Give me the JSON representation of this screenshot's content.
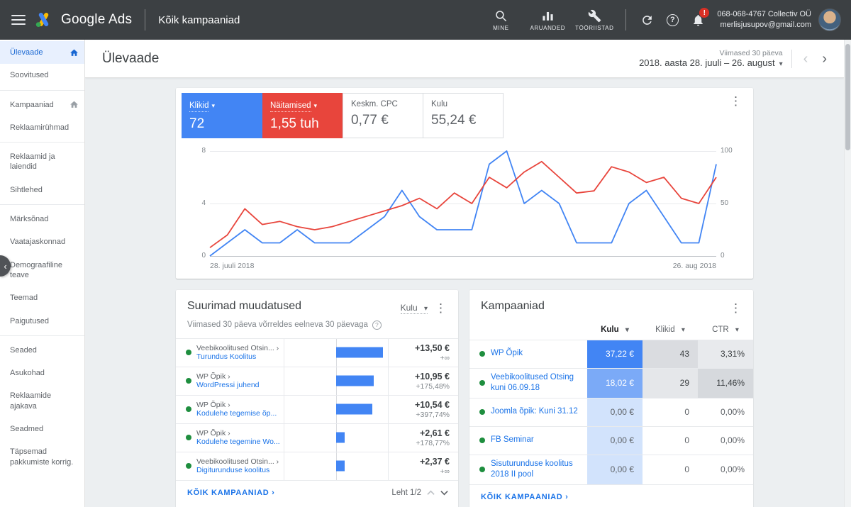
{
  "topbar": {
    "brand": "Google Ads",
    "page_title": "Kõik kampaaniad",
    "actions": [
      {
        "label": "MINE"
      },
      {
        "label": "ARUANDED"
      },
      {
        "label": "TÖÖRIISTAD"
      }
    ],
    "alert_badge": "!",
    "account_name": "068-068-4767 Collectiv OÜ",
    "account_email": "merlisjusupov@gmail.com"
  },
  "sidebar": {
    "items": [
      {
        "label": "Ülevaade"
      },
      {
        "label": "Soovitused"
      },
      {
        "label": "Kampaaniad"
      },
      {
        "label": "Reklaamirühmad"
      },
      {
        "label": "Reklaamid ja laiendid"
      },
      {
        "label": "Sihtlehed"
      },
      {
        "label": "Märksõnad"
      },
      {
        "label": "Vaatajaskonnad"
      },
      {
        "label": "Demograafiline teave"
      },
      {
        "label": "Teemad"
      },
      {
        "label": "Paigutused"
      },
      {
        "label": "Seaded"
      },
      {
        "label": "Asukohad"
      },
      {
        "label": "Reklaamide ajakava"
      },
      {
        "label": "Seadmed"
      },
      {
        "label": "Täpsemad pakkumiste korrig."
      }
    ]
  },
  "header": {
    "title": "Ülevaade",
    "date_preset": "Viimased 30 päeva",
    "date_range": "2018. aasta 28. juuli – 26. august"
  },
  "metrics": [
    {
      "label": "Klikid",
      "value": "72",
      "color": "#4285f4"
    },
    {
      "label": "Näitamised",
      "value": "1,55 tuh",
      "color": "#e8453c"
    },
    {
      "label": "Keskm. CPC",
      "value": "0,77 €"
    },
    {
      "label": "Kulu",
      "value": "55,24 €"
    }
  ],
  "chart_data": {
    "type": "line",
    "x_start_label": "28. juuli 2018",
    "x_end_label": "26. aug 2018",
    "left_axis": {
      "ticks": [
        "8",
        "4",
        "0"
      ],
      "max": 8
    },
    "right_axis": {
      "ticks": [
        "100",
        "50",
        "0"
      ],
      "max": 100
    },
    "series": [
      {
        "name": "Klikid",
        "axis": "left",
        "color": "#4285f4",
        "values": [
          0,
          1,
          2,
          1,
          1,
          2,
          1,
          1,
          1,
          2,
          3,
          5,
          3,
          2,
          2,
          2,
          7,
          8,
          4,
          5,
          4,
          1,
          1,
          1,
          4,
          5,
          3,
          1,
          1,
          7
        ]
      },
      {
        "name": "Näitamised",
        "axis": "right",
        "color": "#e8453c",
        "values": [
          8,
          20,
          45,
          30,
          33,
          28,
          25,
          28,
          33,
          38,
          43,
          48,
          55,
          45,
          60,
          50,
          75,
          65,
          80,
          90,
          75,
          60,
          62,
          85,
          80,
          70,
          75,
          55,
          50,
          75
        ]
      }
    ]
  },
  "top_changes": {
    "title": "Suurimad muudatused",
    "subtitle": "Viimased 30 päeva võrreldes eelneva 30 päevaga",
    "metric_selector": "Kulu",
    "rows": [
      {
        "path": "Veebikoolitused Otsin... ›",
        "name": "Turundus Koolitus",
        "bar_pct": 100,
        "change": "+13,50 €",
        "change_pct": "+∞"
      },
      {
        "path": "WP Õpik ›",
        "name": "WordPressi juhend",
        "bar_pct": 81,
        "change": "+10,95 €",
        "change_pct": "+175,48%"
      },
      {
        "path": "WP Õpik ›",
        "name": "Kodulehe tegemise õp...",
        "bar_pct": 78,
        "change": "+10,54 €",
        "change_pct": "+397,74%"
      },
      {
        "path": "WP Õpik ›",
        "name": "Kodulehe tegemine Wo...",
        "bar_pct": 19,
        "change": "+2,61 €",
        "change_pct": "+178,77%"
      },
      {
        "path": "Veebikoolitused Otsin... ›",
        "name": "Digiturunduse koolitus",
        "bar_pct": 18,
        "change": "+2,37 €",
        "change_pct": "+∞"
      }
    ],
    "footer_link": "KÕIK KAMPAANIAD",
    "footer_arrow": "›",
    "pagination": "Leht 1/2"
  },
  "campaigns": {
    "title": "Kampaaniad",
    "columns": [
      {
        "label": "Kulu"
      },
      {
        "label": "Klikid"
      },
      {
        "label": "CTR"
      }
    ],
    "rows": [
      {
        "name": "WP Õpik",
        "kulu": "37,22 €",
        "klikid": "43",
        "ctr": "3,31%",
        "kulu_bg": "#4285f4",
        "kulu_fg": "#ffffff",
        "klikid_bg": "#dadce0",
        "klikid_fg": "#3c4043",
        "ctr_bg": "#e8eaed",
        "ctr_fg": "#3c4043"
      },
      {
        "name": "Veebikoolitused Otsing kuni 06.09.18",
        "kulu": "18,02 €",
        "klikid": "29",
        "ctr": "11,46%",
        "kulu_bg": "#7baaf7",
        "kulu_fg": "#ffffff",
        "klikid_bg": "#e5e7ea",
        "klikid_fg": "#3c4043",
        "ctr_bg": "#d6d9dd",
        "ctr_fg": "#3c4043"
      },
      {
        "name": "Joomla õpik: Kuni 31.12",
        "kulu": "0,00 €",
        "klikid": "0",
        "ctr": "0,00%",
        "kulu_bg": "#d2e3fc",
        "kulu_fg": "#5f6368",
        "klikid_bg": "#ffffff",
        "klikid_fg": "#5f6368",
        "ctr_bg": "#ffffff",
        "ctr_fg": "#5f6368"
      },
      {
        "name": "FB Seminar",
        "kulu": "0,00 €",
        "klikid": "0",
        "ctr": "0,00%",
        "kulu_bg": "#d2e3fc",
        "kulu_fg": "#5f6368",
        "klikid_bg": "#ffffff",
        "klikid_fg": "#5f6368",
        "ctr_bg": "#ffffff",
        "ctr_fg": "#5f6368"
      },
      {
        "name": "Sisuturunduse koolitus 2018 II pool",
        "kulu": "0,00 €",
        "klikid": "0",
        "ctr": "0,00%",
        "kulu_bg": "#d2e3fc",
        "kulu_fg": "#5f6368",
        "klikid_bg": "#ffffff",
        "klikid_fg": "#5f6368",
        "ctr_bg": "#ffffff",
        "ctr_fg": "#5f6368"
      }
    ],
    "footer_link": "KÕIK KAMPAANIAD",
    "footer_arrow": "›"
  }
}
